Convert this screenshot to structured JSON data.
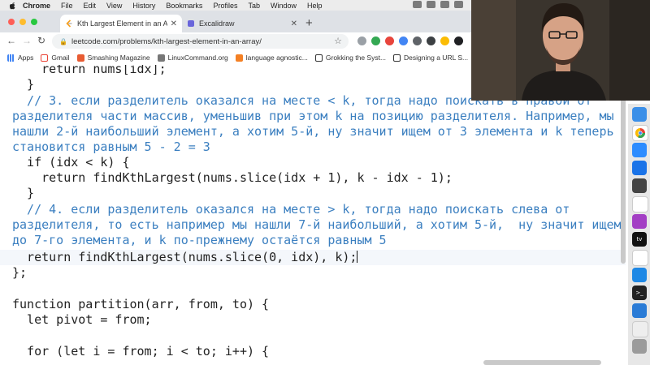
{
  "menubar": {
    "app": "Chrome",
    "items": [
      "File",
      "Edit",
      "View",
      "History",
      "Bookmarks",
      "Profiles",
      "Tab",
      "Window",
      "Help"
    ]
  },
  "tabs": [
    {
      "title": "Kth Largest Element in an Array",
      "active": true,
      "icon": "leetcode-icon"
    },
    {
      "title": "Excalidraw",
      "active": false,
      "icon": "excalidraw-icon"
    }
  ],
  "address": {
    "url": "leetcode.com/problems/kth-largest-element-in-an-array/"
  },
  "bookmarks": [
    {
      "label": "Apps",
      "icon": "apps-grid-icon"
    },
    {
      "label": "Gmail",
      "icon": "gmail-icon"
    },
    {
      "label": "Smashing Magazine",
      "icon": "smashing-icon"
    },
    {
      "label": "LinuxCommand.org",
      "icon": "linuxcommand-icon"
    },
    {
      "label": "language agnostic...",
      "icon": "bookmark-icon"
    },
    {
      "label": "Grokking the Syst...",
      "icon": "grokking-icon"
    },
    {
      "label": "Designing a URL S...",
      "icon": "bookmark-icon"
    }
  ],
  "code": {
    "l1": "    return nums[idx];",
    "l2": "  }",
    "l3": "  // 3. если разделитель оказался на месте < k, тогда надо поискать в правой от",
    "l4": "разделителя части массив, уменьшив при этом k на позицию разделителя. Например, мы",
    "l5": "нашли 2-й наибольший элемент, а хотим 5-й, ну значит ищем от 3 элемента и k теперь",
    "l6": "становится равным 5 - 2 = 3",
    "l7": "  if (idx < k) {",
    "l8": "    return findKthLargest(nums.slice(idx + 1), k - idx - 1);",
    "l9": "  }",
    "l10": "  // 4. если разделитель оказался на месте > k, тогда надо поискать слева от",
    "l11": "разделителя, то есть например мы нашли 7-й наибольший, а хотим 5-й,  ну значит ищем",
    "l12": "до 7-го элемента, и k по-прежнему остаётся равным 5",
    "l13": "  return findKthLargest(nums.slice(0, idx), k);",
    "l14": "};",
    "l15": "",
    "l16": "function partition(arr, from, to) {",
    "l17": "  let pivot = from;",
    "l18": "",
    "l19": "  for (let i = from; i < to; i++) {"
  },
  "colors": {
    "comment": "#3b7fc0",
    "keyword": "#1e61b8",
    "text": "#222222"
  }
}
